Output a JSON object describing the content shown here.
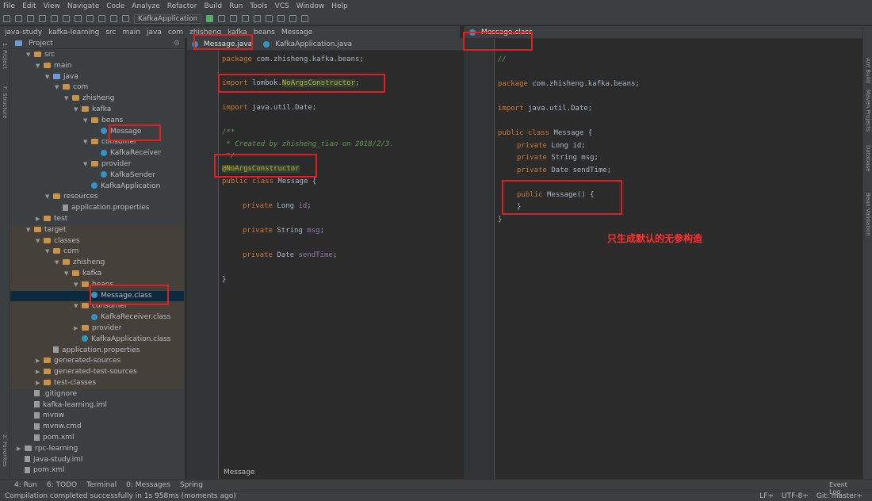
{
  "menu": [
    "File",
    "Edit",
    "View",
    "Navigate",
    "Code",
    "Analyze",
    "Refactor",
    "Build",
    "Run",
    "Tools",
    "VCS",
    "Window",
    "Help"
  ],
  "toolbar": {
    "run_config": "KafkaApplication"
  },
  "navbar": [
    "java-study",
    "kafka-learning",
    "src",
    "main",
    "java",
    "com",
    "zhisheng",
    "kafka",
    "beans",
    "Message"
  ],
  "project_panel": {
    "title": "Project"
  },
  "tree": [
    {
      "label": "src",
      "depth": 1,
      "icon": "folder",
      "open": true
    },
    {
      "label": "main",
      "depth": 2,
      "icon": "folder",
      "open": true
    },
    {
      "label": "java",
      "depth": 3,
      "icon": "folder-blue",
      "open": true
    },
    {
      "label": "com",
      "depth": 4,
      "icon": "folder",
      "open": true
    },
    {
      "label": "zhisheng",
      "depth": 5,
      "icon": "folder",
      "open": true
    },
    {
      "label": "kafka",
      "depth": 6,
      "icon": "folder",
      "open": true
    },
    {
      "label": "beans",
      "depth": 7,
      "icon": "folder",
      "open": true
    },
    {
      "label": "Message",
      "depth": 8,
      "icon": "class"
    },
    {
      "label": "consumer",
      "depth": 7,
      "icon": "folder",
      "open": true
    },
    {
      "label": "KafkaReceiver",
      "depth": 8,
      "icon": "class"
    },
    {
      "label": "provider",
      "depth": 7,
      "icon": "folder",
      "open": true
    },
    {
      "label": "KafkaSender",
      "depth": 8,
      "icon": "class"
    },
    {
      "label": "KafkaApplication",
      "depth": 7,
      "icon": "class"
    },
    {
      "label": "resources",
      "depth": 3,
      "icon": "folder",
      "open": true
    },
    {
      "label": "application.properties",
      "depth": 4,
      "icon": "file"
    },
    {
      "label": "test",
      "depth": 2,
      "icon": "folder",
      "open": false
    },
    {
      "label": "target",
      "depth": 1,
      "icon": "folder",
      "open": true,
      "excluded": true
    },
    {
      "label": "classes",
      "depth": 2,
      "icon": "folder",
      "open": true,
      "excluded": true
    },
    {
      "label": "com",
      "depth": 3,
      "icon": "folder",
      "open": true,
      "excluded": true
    },
    {
      "label": "zhisheng",
      "depth": 4,
      "icon": "folder",
      "open": true,
      "excluded": true
    },
    {
      "label": "kafka",
      "depth": 5,
      "icon": "folder",
      "open": true,
      "excluded": true
    },
    {
      "label": "beans",
      "depth": 6,
      "icon": "folder",
      "open": true,
      "excluded": true
    },
    {
      "label": "Message.class",
      "depth": 7,
      "icon": "class",
      "selected": true
    },
    {
      "label": "consumer",
      "depth": 6,
      "icon": "folder",
      "open": true,
      "excluded": true
    },
    {
      "label": "KafkaReceiver.class",
      "depth": 7,
      "icon": "class",
      "excluded": true
    },
    {
      "label": "provider",
      "depth": 6,
      "icon": "folder",
      "open": false,
      "excluded": true
    },
    {
      "label": "KafkaApplication.class",
      "depth": 6,
      "icon": "class",
      "excluded": true
    },
    {
      "label": "application.properties",
      "depth": 3,
      "icon": "file",
      "excluded": true
    },
    {
      "label": "generated-sources",
      "depth": 2,
      "icon": "folder",
      "open": false,
      "excluded": true
    },
    {
      "label": "generated-test-sources",
      "depth": 2,
      "icon": "folder",
      "open": false,
      "excluded": true
    },
    {
      "label": "test-classes",
      "depth": 2,
      "icon": "folder",
      "open": false,
      "excluded": true
    },
    {
      "label": ".gitignore",
      "depth": 1,
      "icon": "file"
    },
    {
      "label": "kafka-learning.iml",
      "depth": 1,
      "icon": "file"
    },
    {
      "label": "mvnw",
      "depth": 1,
      "icon": "file"
    },
    {
      "label": "mvnw.cmd",
      "depth": 1,
      "icon": "file"
    },
    {
      "label": "pom.xml",
      "depth": 1,
      "icon": "file"
    },
    {
      "label": "rpc-learning",
      "depth": 0,
      "icon": "folder-gray",
      "open": false
    },
    {
      "label": "java-study.iml",
      "depth": 0,
      "icon": "file"
    },
    {
      "label": "pom.xml",
      "depth": 0,
      "icon": "file"
    }
  ],
  "left_editor": {
    "tabs": [
      "Message.java",
      "KafkaApplication.java"
    ],
    "breadcrumb": "Message"
  },
  "right_editor": {
    "tabs": [
      "Message.class"
    ]
  },
  "annotation": "只生成默认的无参构造",
  "bottom_tools": [
    "4: Run",
    "6: TODO",
    "Terminal",
    "0: Messages",
    "Spring"
  ],
  "status": {
    "message": "Compilation completed successfully in 1s 958ms (moments ago)",
    "event_log": "Event Log",
    "right": [
      "LF÷",
      "UTF-8÷",
      "Git: master÷"
    ]
  }
}
